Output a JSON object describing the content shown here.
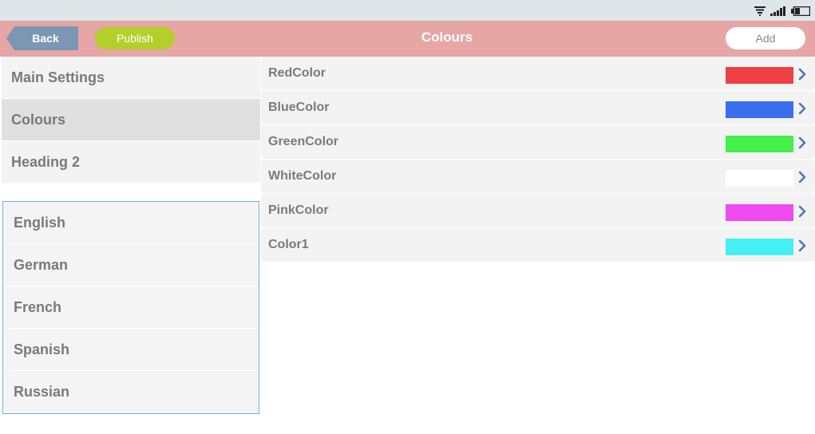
{
  "header": {
    "back_label": "Back",
    "publish_label": "Publish",
    "title": "Colours",
    "add_label": "Add",
    "colors": {
      "bar": "#e6a6a6",
      "back": "#7b97b4",
      "publish": "#b5cf2a"
    }
  },
  "status_bar": {
    "icons": [
      "wifi-icon",
      "signal-icon",
      "battery-icon"
    ]
  },
  "sidebar": {
    "items": [
      {
        "label": "Main Settings"
      },
      {
        "label": "Colours",
        "selected": true
      },
      {
        "label": "Heading 2"
      }
    ]
  },
  "languages": {
    "items": [
      {
        "label": "English"
      },
      {
        "label": "German"
      },
      {
        "label": "French"
      },
      {
        "label": "Spanish"
      },
      {
        "label": "Russian"
      }
    ]
  },
  "colors_list": {
    "items": [
      {
        "name": "RedColor",
        "swatch": "#ef4045"
      },
      {
        "name": "BlueColor",
        "swatch": "#3b6ff0"
      },
      {
        "name": "GreenColor",
        "swatch": "#45f04a"
      },
      {
        "name": "WhiteColor",
        "swatch": "#ffffff"
      },
      {
        "name": "PinkColor",
        "swatch": "#f04af0"
      },
      {
        "name": "Color1",
        "swatch": "#45f0f5"
      }
    ]
  }
}
